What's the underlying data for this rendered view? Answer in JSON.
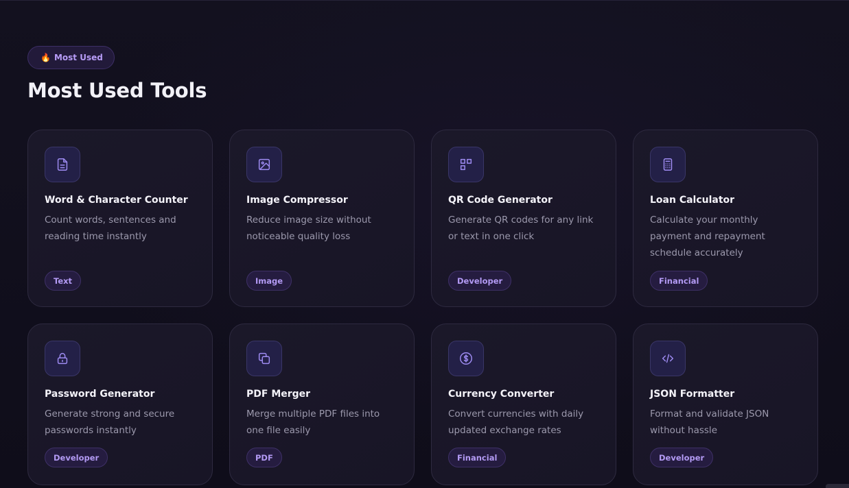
{
  "badge": {
    "emoji": "🔥",
    "label": "Most Used"
  },
  "heading": "Most Used Tools",
  "colors": {
    "accent": "#b39af4",
    "icon": "#9f8cf3",
    "background": "#0f0d1b",
    "card": "#1a1728"
  },
  "tools": [
    {
      "title": "Word & Character Counter",
      "description": "Count words, sentences and reading time instantly",
      "tag": "Text",
      "icon": "document-icon"
    },
    {
      "title": "Image Compressor",
      "description": "Reduce image size without noticeable quality loss",
      "tag": "Image",
      "icon": "image-icon"
    },
    {
      "title": "QR Code Generator",
      "description": "Generate QR codes for any link or text in one click",
      "tag": "Developer",
      "icon": "qr-code-icon"
    },
    {
      "title": "Loan Calculator",
      "description": "Calculate your monthly payment and repayment schedule accurately",
      "tag": "Financial",
      "icon": "calculator-icon"
    },
    {
      "title": "Password Generator",
      "description": "Generate strong and secure passwords instantly",
      "tag": "Developer",
      "icon": "lock-icon"
    },
    {
      "title": "PDF Merger",
      "description": "Merge multiple PDF files into one file easily",
      "tag": "PDF",
      "icon": "copy-icon"
    },
    {
      "title": "Currency Converter",
      "description": "Convert currencies with daily updated exchange rates",
      "tag": "Financial",
      "icon": "dollar-circle-icon"
    },
    {
      "title": "JSON Formatter",
      "description": "Format and validate JSON without hassle",
      "tag": "Developer",
      "icon": "code-icon"
    }
  ]
}
